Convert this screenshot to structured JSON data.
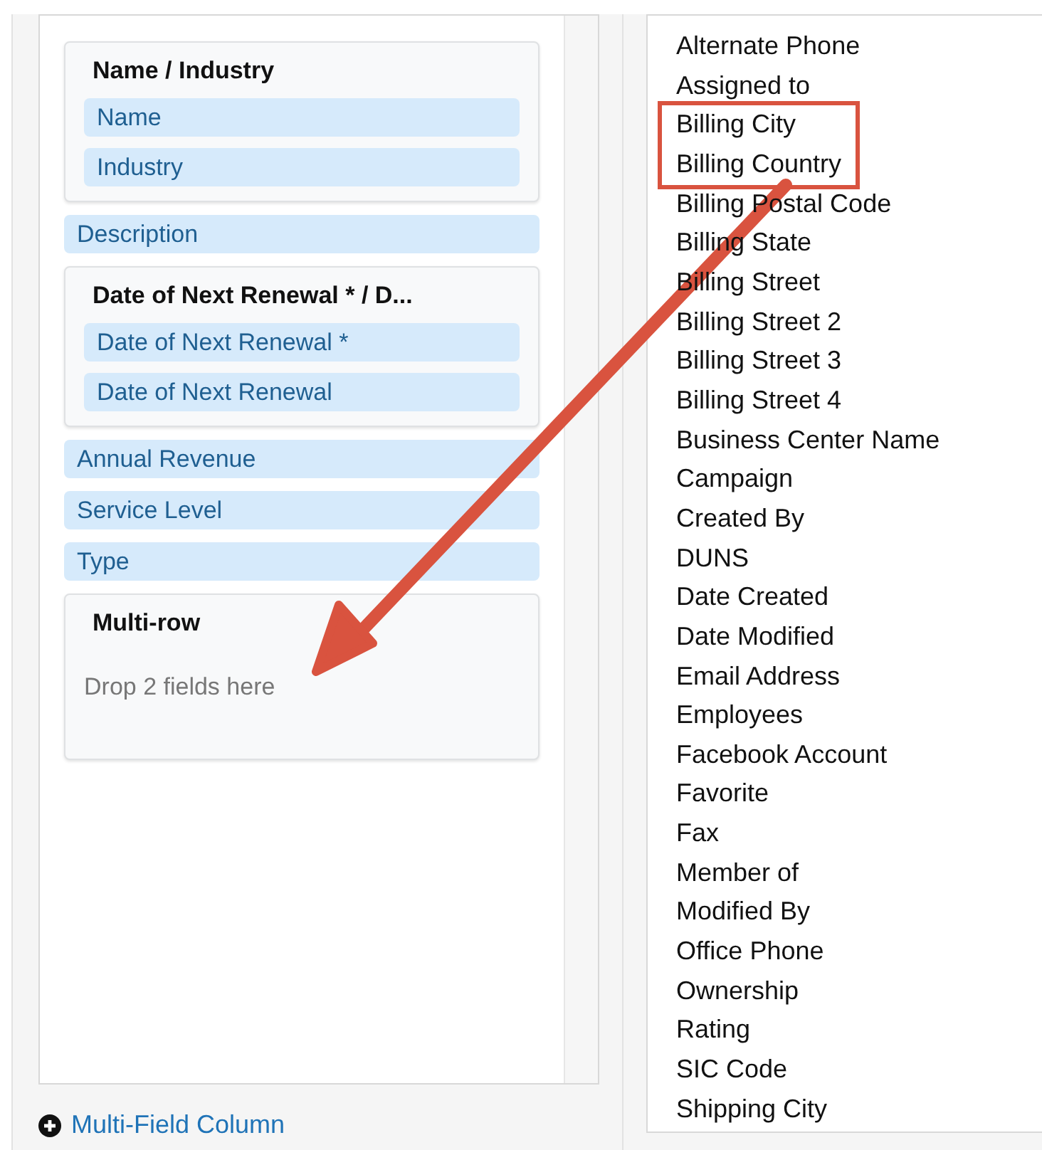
{
  "layout_panel": {
    "items": [
      {
        "kind": "group",
        "title": "Name / Industry",
        "fields": [
          "Name",
          "Industry"
        ]
      },
      {
        "kind": "field",
        "label": "Description"
      },
      {
        "kind": "group",
        "title": "Date of Next Renewal * / D...",
        "fields": [
          "Date of Next Renewal *",
          "Date of Next Renewal"
        ]
      },
      {
        "kind": "field",
        "label": "Annual Revenue"
      },
      {
        "kind": "field",
        "label": "Service Level"
      },
      {
        "kind": "field",
        "label": "Type"
      },
      {
        "kind": "group",
        "title": "Multi-row",
        "hint": "Drop 2 fields here"
      }
    ],
    "add_link": "Multi-Field Column"
  },
  "available_fields": [
    {
      "label": "Alternate Phone",
      "highlighted": false
    },
    {
      "label": "Assigned to",
      "highlighted": false
    },
    {
      "label": "Billing City",
      "highlighted": true
    },
    {
      "label": "Billing Country",
      "highlighted": true
    },
    {
      "label": "Billing Postal Code",
      "highlighted": false
    },
    {
      "label": "Billing State",
      "highlighted": false
    },
    {
      "label": "Billing Street",
      "highlighted": false
    },
    {
      "label": "Billing Street 2",
      "highlighted": false
    },
    {
      "label": "Billing Street 3",
      "highlighted": false
    },
    {
      "label": "Billing Street 4",
      "highlighted": false
    },
    {
      "label": "Business Center Name",
      "highlighted": false
    },
    {
      "label": "Campaign",
      "highlighted": false
    },
    {
      "label": "Created By",
      "highlighted": false
    },
    {
      "label": "DUNS",
      "highlighted": false
    },
    {
      "label": "Date Created",
      "highlighted": false
    },
    {
      "label": "Date Modified",
      "highlighted": false
    },
    {
      "label": "Email Address",
      "highlighted": false
    },
    {
      "label": "Employees",
      "highlighted": false
    },
    {
      "label": "Facebook Account",
      "highlighted": false
    },
    {
      "label": "Favorite",
      "highlighted": false
    },
    {
      "label": "Fax",
      "highlighted": false
    },
    {
      "label": "Member of",
      "highlighted": false
    },
    {
      "label": "Modified By",
      "highlighted": false
    },
    {
      "label": "Office Phone",
      "highlighted": false
    },
    {
      "label": "Ownership",
      "highlighted": false
    },
    {
      "label": "Rating",
      "highlighted": false
    },
    {
      "label": "SIC Code",
      "highlighted": false
    },
    {
      "label": "Shipping City",
      "highlighted": false
    }
  ]
}
